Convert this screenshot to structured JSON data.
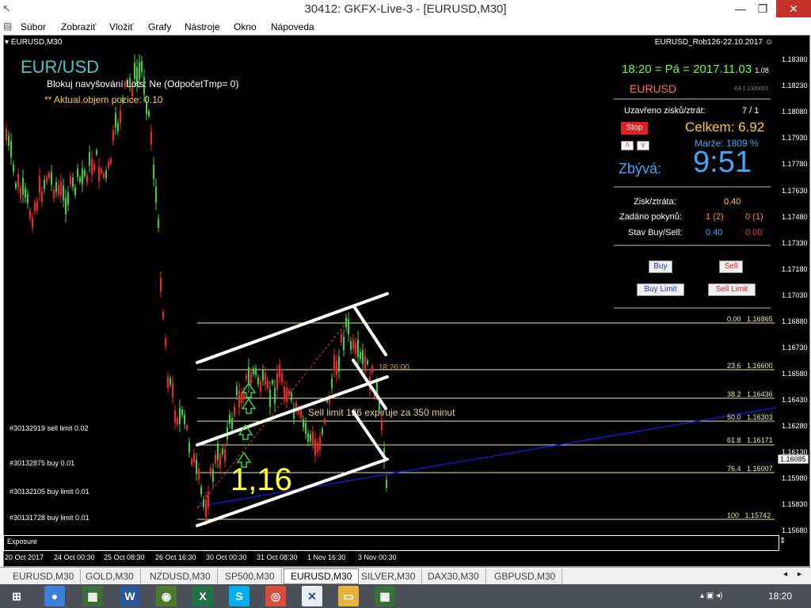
{
  "window": {
    "title": "30412: GKFX-Live-3 - [EURUSD,M30]"
  },
  "menu": [
    "Súbor",
    "Zobraziť",
    "Vložiť",
    "Grafy",
    "Nástroje",
    "Okno",
    "Nápoveda"
  ],
  "chart": {
    "header_left": "EURUSD,M30",
    "header_right": "EURUSD_Rob126-22.10.2017",
    "symbol_title": "EUR/USD",
    "info_line1": "Blokuj navyšování Lots:  Ne   (OdpočetTmp= 0)",
    "info_line2": "** Aktual.objem pozice: 0.10",
    "big_label": "1,16",
    "sell_limit_note": "Sell limit 126 expiruje za 350 minut",
    "time_marker": "18:26:00",
    "current_price": "1.16085",
    "exposure_label": "Exposure",
    "price_axis": [
      "1.18380",
      "1.18230",
      "1.18080",
      "1.17930",
      "1.17780",
      "1.17630",
      "1.17480",
      "1.17330",
      "1.17180",
      "1.17030",
      "1.16880",
      "1.16730",
      "1.16580",
      "1.16430",
      "1.16280",
      "1.16130",
      "1.15980",
      "1.15830",
      "1.15680"
    ],
    "time_axis": [
      "20 Oct 2017",
      "24 Oct 00:30",
      "25 Oct 08:30",
      "26 Oct 16:30",
      "30 Oct 00:30",
      "31 Oct 08:30",
      "1 Nov 16:30",
      "3 Nov 00:30"
    ],
    "fib_levels": [
      {
        "pct": "0.00",
        "price": "1.16865"
      },
      {
        "pct": "23.6",
        "price": "1.16600"
      },
      {
        "pct": "38.2",
        "price": "1.16436"
      },
      {
        "pct": "50.0",
        "price": "1.16303"
      },
      {
        "pct": "61.8",
        "price": "1.16171"
      },
      {
        "pct": "76.4",
        "price": "1.16007"
      },
      {
        "pct": "100",
        "price": "1.15742"
      }
    ],
    "orders": [
      "#30132919 sell limit 0.02",
      "#30132875 buy 0.01",
      "#30132105 buy limit 0.01",
      "#30131728 buy limit 0.01"
    ]
  },
  "panel": {
    "datetime": "18:20 = Pá = 2017.11.03",
    "datetime_suffix": "1.08",
    "symbol": "EURUSD",
    "ea_label": "EA č.1300001",
    "closed_label": "Uzavřeno zisků/ztrát:",
    "closed_value": "7 / 1",
    "stop_btn": "Stop",
    "total_label": "Celkem: 6.92",
    "margin_label": "Marže:  1809 %",
    "remaining_label": "Zbývá:",
    "remaining_value": "9:51",
    "pl_label": "Zisk/ztráta:",
    "pl_value": "0.40",
    "orders_label": "Zadáno pokynů:",
    "orders_buy": "1 (2)",
    "orders_sell": "0 (1)",
    "state_label": "Stav Buy/Sell:",
    "state_buy": "0.40",
    "state_sell": "0.00",
    "buy_btn": "Buy",
    "sell_btn": "Sell",
    "buy_limit_btn": "Buy Limit",
    "sell_limit_btn": "Sell Limit"
  },
  "tabs": [
    "EURUSD,M30",
    "GOLD,M30",
    "NZDUSD,M30",
    "SP500,M30",
    "EURUSD,M30",
    "SILVER,M30",
    "DAX30,M30",
    "GBPUSD,M30"
  ],
  "active_tab": 4,
  "taskbar": {
    "clock": "18:20"
  },
  "colors": {
    "fib": "#e8e8a0",
    "bull": "#39d439",
    "bear": "#ff2020",
    "trend": "#1a1aff",
    "channel": "#ffffff"
  }
}
